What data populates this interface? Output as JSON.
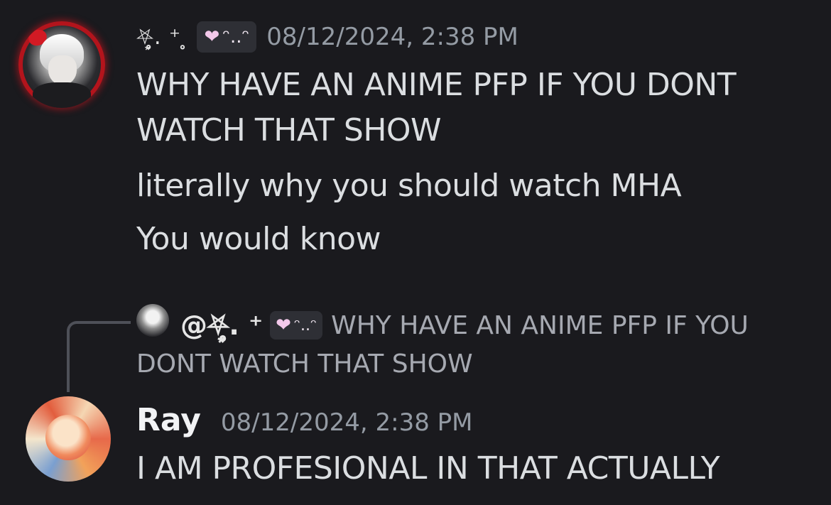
{
  "message_1": {
    "author_decoration": "⛧̥͙. ⁺ ̥",
    "tag": "ᵔ..ᵔ",
    "heart_icon": "pink-heart",
    "timestamp": "08/12/2024, 2:38 PM",
    "lines": [
      "WHY HAVE AN ANIME PFP IF YOU DONT WATCH THAT SHOW",
      "literally why you should watch MHA",
      "You would know"
    ]
  },
  "reply": {
    "mention": "@⛧̥͙. ⁺",
    "tag": "ᵔ..ᵔ",
    "preview_line_1": "WHY HAVE AN ANIME PFP IF YOU",
    "preview_line_2": "DONT WATCH THAT SHOW"
  },
  "message_2": {
    "username": "Ray",
    "timestamp": "08/12/2024, 2:38 PM",
    "text": "I AM PROFESIONAL IN THAT ACTUALLY"
  },
  "colors": {
    "background": "#1a1a1e",
    "text": "#dbdee1",
    "muted": "#949ba4",
    "avatar_ring": "#b3141c"
  }
}
